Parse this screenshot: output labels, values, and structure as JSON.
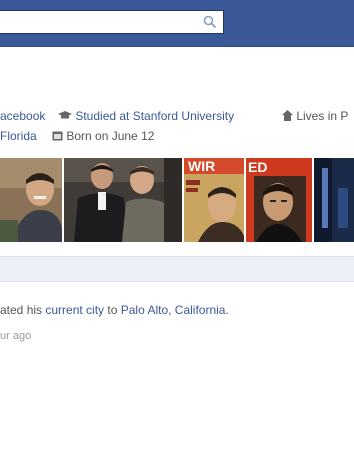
{
  "header": {
    "search_placeholder": ""
  },
  "profile_info": {
    "work_link": "acebook",
    "studied": "Studied at Stanford University",
    "lives_prefix": "Lives in P",
    "from_city": "Florida",
    "born": "Born on June 12"
  },
  "photos": [
    {
      "label": "photo-1"
    },
    {
      "label": "photo-2"
    },
    {
      "label": "photo-3"
    },
    {
      "label": "photo-4"
    },
    {
      "label": "photo-5"
    }
  ],
  "story": {
    "prefix": "ated his ",
    "link1": "current city",
    "middle": " to ",
    "link2": "Palo Alto, California",
    "suffix": ".",
    "time": "ur ago"
  },
  "colors": {
    "brand": "#3b5998",
    "band": "#eceff5"
  }
}
